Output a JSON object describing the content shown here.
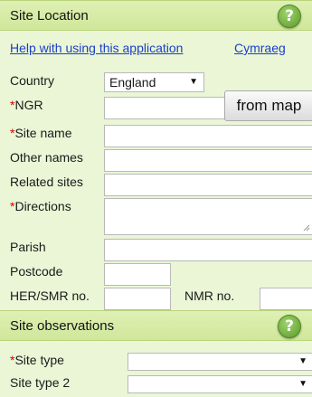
{
  "site_location": {
    "title": "Site Location",
    "help_label": "?",
    "help_link": "Help with using this application",
    "language_link": "Cymraeg",
    "country_label": "Country",
    "country_value": "England",
    "ngr_label": "NGR",
    "from_map_label": "from map",
    "site_name_label": "Site name",
    "other_names_label": "Other names",
    "related_sites_label": "Related sites",
    "directions_label": "Directions",
    "parish_label": "Parish",
    "postcode_label": "Postcode",
    "her_smr_label": "HER/SMR no.",
    "nmr_label": "NMR no.",
    "required_marker": "*"
  },
  "site_observations": {
    "title": "Site observations",
    "help_label": "?",
    "site_type_label": "Site type",
    "site_type_2_label": "Site type 2",
    "required_marker": "*"
  },
  "icons": {
    "dropdown_arrow": "▼"
  }
}
